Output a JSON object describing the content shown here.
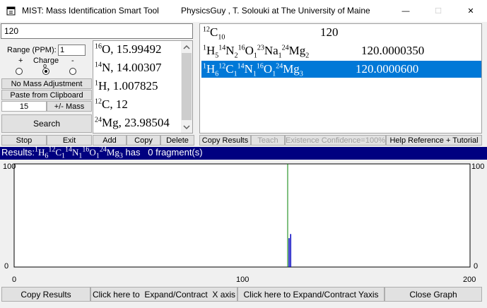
{
  "window": {
    "title": "MIST: Mass Identification Smart Tool",
    "author": "PhysicsGuy , T. Solouki at The University of Maine",
    "controls": {
      "minimize": "—",
      "maximize": "☐",
      "close": "✕"
    }
  },
  "input": {
    "mass_value": "120"
  },
  "left_panel": {
    "range_label": "Range (PPM):",
    "range_value": "1",
    "charge_label": "Charge",
    "charge_options": [
      "+",
      "o",
      "-"
    ],
    "charge_selected": "o",
    "no_mass_adjustment": "No Mass Adjustment",
    "paste_clipboard": "Paste from Clipboard",
    "mass_tolerance_value": "15",
    "plus_minus_mass": "+/- Mass",
    "search": "Search"
  },
  "element_list": [
    {
      "isotope": "16",
      "symbol": "O",
      "mass": ", 15.99492"
    },
    {
      "isotope": "14",
      "symbol": "N",
      "mass": ", 14.00307"
    },
    {
      "isotope": "1",
      "symbol": "H",
      "mass": ", 1.007825"
    },
    {
      "isotope": "12",
      "symbol": "C",
      "mass": ", 12"
    },
    {
      "isotope": "24",
      "symbol": "Mg",
      "mass": ", 23.98504"
    }
  ],
  "results": [
    {
      "formula_label": "12C10",
      "value": "120",
      "selected": false
    },
    {
      "formula_label": "1H5 14N2 16O1 23Na1 24Mg2",
      "value": "120.0000350",
      "selected": false
    },
    {
      "formula_label": "1H6 12C1 14N1 16O1 24Mg3",
      "value": "120.0000600",
      "selected": true
    }
  ],
  "toolbar": {
    "stop": "Stop",
    "exit": "Exit",
    "add": "Add",
    "copy": "Copy",
    "delete": "Delete",
    "copy_results": "Copy Results",
    "teach": "Teach",
    "existence_confidence": "Existence Confidence=100%",
    "help": "Help Reference + Tutorial"
  },
  "results_bar": {
    "prefix": "Results:",
    "formula_label": "1H6 12C1 14N1 16O1 24Mg3",
    "suffix": " has   0 fragment(s)"
  },
  "chart_data": {
    "type": "bar",
    "xlim": [
      0,
      200
    ],
    "ylim": [
      0,
      100
    ],
    "x_ticks": [
      "0",
      "100",
      "200"
    ],
    "y_ticks_left": [
      "100",
      "0"
    ],
    "y_ticks_right": [
      "100",
      "0"
    ],
    "marker_x": 120,
    "marker_color": "#008000",
    "series": [
      {
        "x": 120.0,
        "y": 28,
        "color": "#0000c0"
      },
      {
        "x": 121.0,
        "y": 32,
        "color": "#0000c0"
      }
    ],
    "grid": false
  },
  "bottom_buttons": {
    "copy_results": "Copy Results",
    "expand_x": "Click here to  Expand/Contract  X axis",
    "expand_y": "Click here to Expand/Contract Yaxis",
    "close_graph": "Close Graph"
  }
}
